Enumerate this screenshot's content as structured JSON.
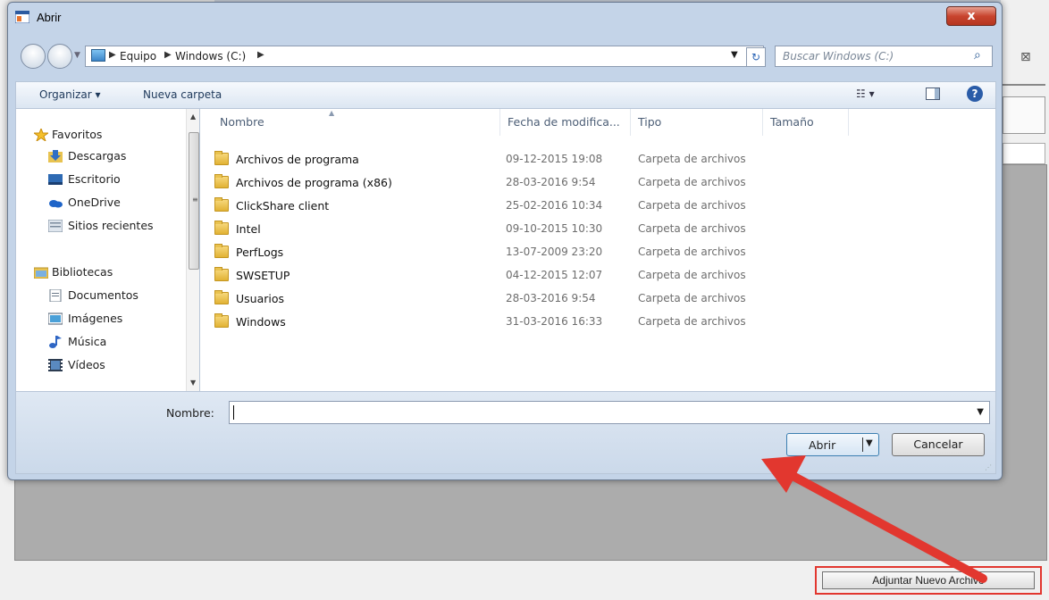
{
  "window": {
    "title": "Abrir",
    "close_label": "x"
  },
  "address": {
    "crumbs": [
      "Equipo",
      "Windows (C:)"
    ],
    "search_placeholder": "Buscar Windows (C:)"
  },
  "toolbar": {
    "organize": "Organizar ▾",
    "new_folder": "Nueva carpeta",
    "help": "?"
  },
  "nav": {
    "favorites": "Favoritos",
    "items": [
      "Descargas",
      "Escritorio",
      "OneDrive",
      "Sitios recientes"
    ],
    "libraries": "Bibliotecas",
    "lib_items": [
      "Documentos",
      "Imágenes",
      "Música",
      "Vídeos"
    ]
  },
  "columns": {
    "name": "Nombre",
    "date": "Fecha de modifica...",
    "type": "Tipo",
    "size": "Tamaño"
  },
  "files": [
    {
      "name": "Archivos de programa",
      "date": "09-12-2015 19:08",
      "type": "Carpeta de archivos"
    },
    {
      "name": "Archivos de programa (x86)",
      "date": "28-03-2016 9:54",
      "type": "Carpeta de archivos"
    },
    {
      "name": "ClickShare client",
      "date": "25-02-2016 10:34",
      "type": "Carpeta de archivos"
    },
    {
      "name": "Intel",
      "date": "09-10-2015 10:30",
      "type": "Carpeta de archivos"
    },
    {
      "name": "PerfLogs",
      "date": "13-07-2009 23:20",
      "type": "Carpeta de archivos"
    },
    {
      "name": "SWSETUP",
      "date": "04-12-2015 12:07",
      "type": "Carpeta de archivos"
    },
    {
      "name": "Usuarios",
      "date": "28-03-2016 9:54",
      "type": "Carpeta de archivos"
    },
    {
      "name": "Windows",
      "date": "31-03-2016 16:33",
      "type": "Carpeta de archivos"
    }
  ],
  "footer": {
    "name_label": "Nombre:",
    "name_value": "",
    "open": "Abrir",
    "cancel": "Cancelar"
  },
  "background": {
    "attach_button": "Adjuntar Nuevo Archivo"
  },
  "colors": {
    "highlight": "#e2372f",
    "close": "#c8452f"
  }
}
